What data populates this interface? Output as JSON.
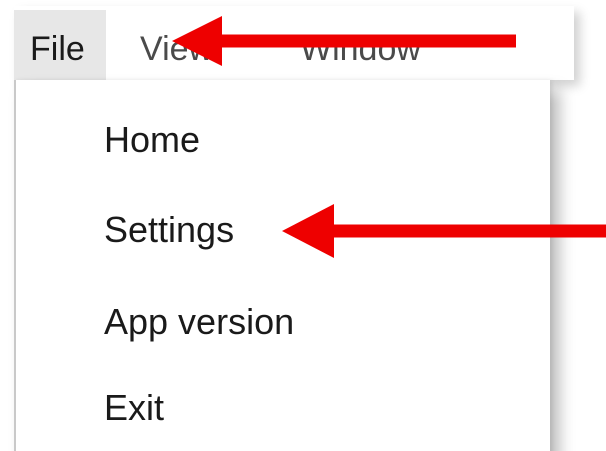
{
  "menubar": {
    "items": [
      {
        "label": "File"
      },
      {
        "label": "View"
      },
      {
        "label": "Window"
      }
    ]
  },
  "dropdown": {
    "items": [
      {
        "label": "Home"
      },
      {
        "label": "Settings"
      },
      {
        "label": "App version"
      },
      {
        "label": "Exit"
      }
    ]
  },
  "colors": {
    "annotation_arrow": "#ee0000",
    "file_highlight": "#e7e7e7"
  }
}
